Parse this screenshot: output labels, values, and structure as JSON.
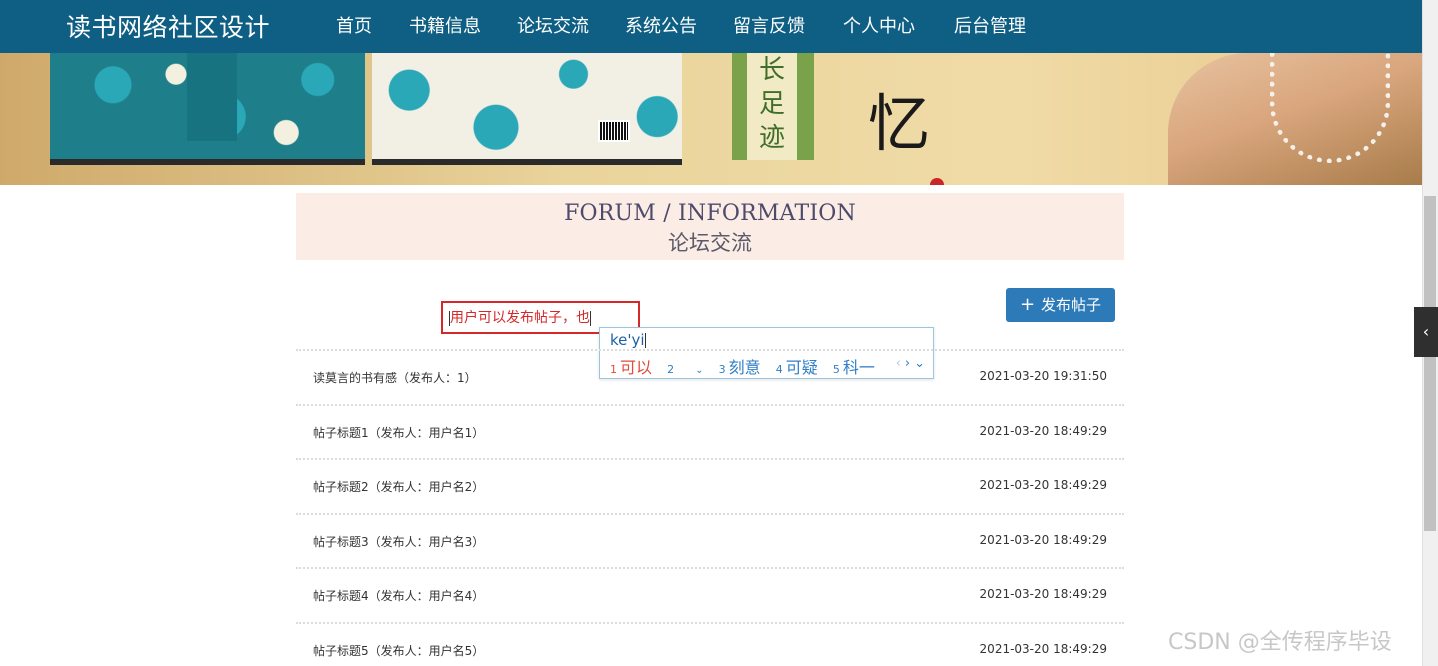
{
  "site": {
    "title": "读书网络社区设计"
  },
  "nav": [
    {
      "label": "首页"
    },
    {
      "label": "书籍信息"
    },
    {
      "label": "论坛交流"
    },
    {
      "label": "系统公告"
    },
    {
      "label": "留言反馈"
    },
    {
      "label": "个人中心"
    },
    {
      "label": "后台管理"
    }
  ],
  "banner": {
    "side_text": "长足迹",
    "calligraphy": "忆"
  },
  "heading": {
    "en": "FORUM / INFORMATION",
    "cn": "论坛交流"
  },
  "search": {
    "value": "用户可以发布帖子，也"
  },
  "ime": {
    "pinyin": "ke'yi",
    "candidates": [
      {
        "n": "1",
        "text": "可以"
      },
      {
        "n": "2",
        "text": ""
      },
      {
        "n": "3",
        "text": "刻意"
      },
      {
        "n": "4",
        "text": "可疑"
      },
      {
        "n": "5",
        "text": "科一"
      }
    ]
  },
  "post_button": {
    "label": "发布帖子"
  },
  "posts": [
    {
      "title": "读莫言的书有感（发布人：1）",
      "time": "2021-03-20 19:31:50"
    },
    {
      "title": "帖子标题1（发布人：用户名1）",
      "time": "2021-03-20 18:49:29"
    },
    {
      "title": "帖子标题2（发布人：用户名2）",
      "time": "2021-03-20 18:49:29"
    },
    {
      "title": "帖子标题3（发布人：用户名3）",
      "time": "2021-03-20 18:49:29"
    },
    {
      "title": "帖子标题4（发布人：用户名4）",
      "time": "2021-03-20 18:49:29"
    },
    {
      "title": "帖子标题5（发布人：用户名5）",
      "time": "2021-03-20 18:49:29"
    }
  ],
  "watermark": "CSDN @全传程序毕设",
  "colors": {
    "nav_bg": "#0f5f84",
    "accent_button": "#2d7ab8",
    "heading_bg": "#fbede6",
    "input_border": "#d62828"
  }
}
